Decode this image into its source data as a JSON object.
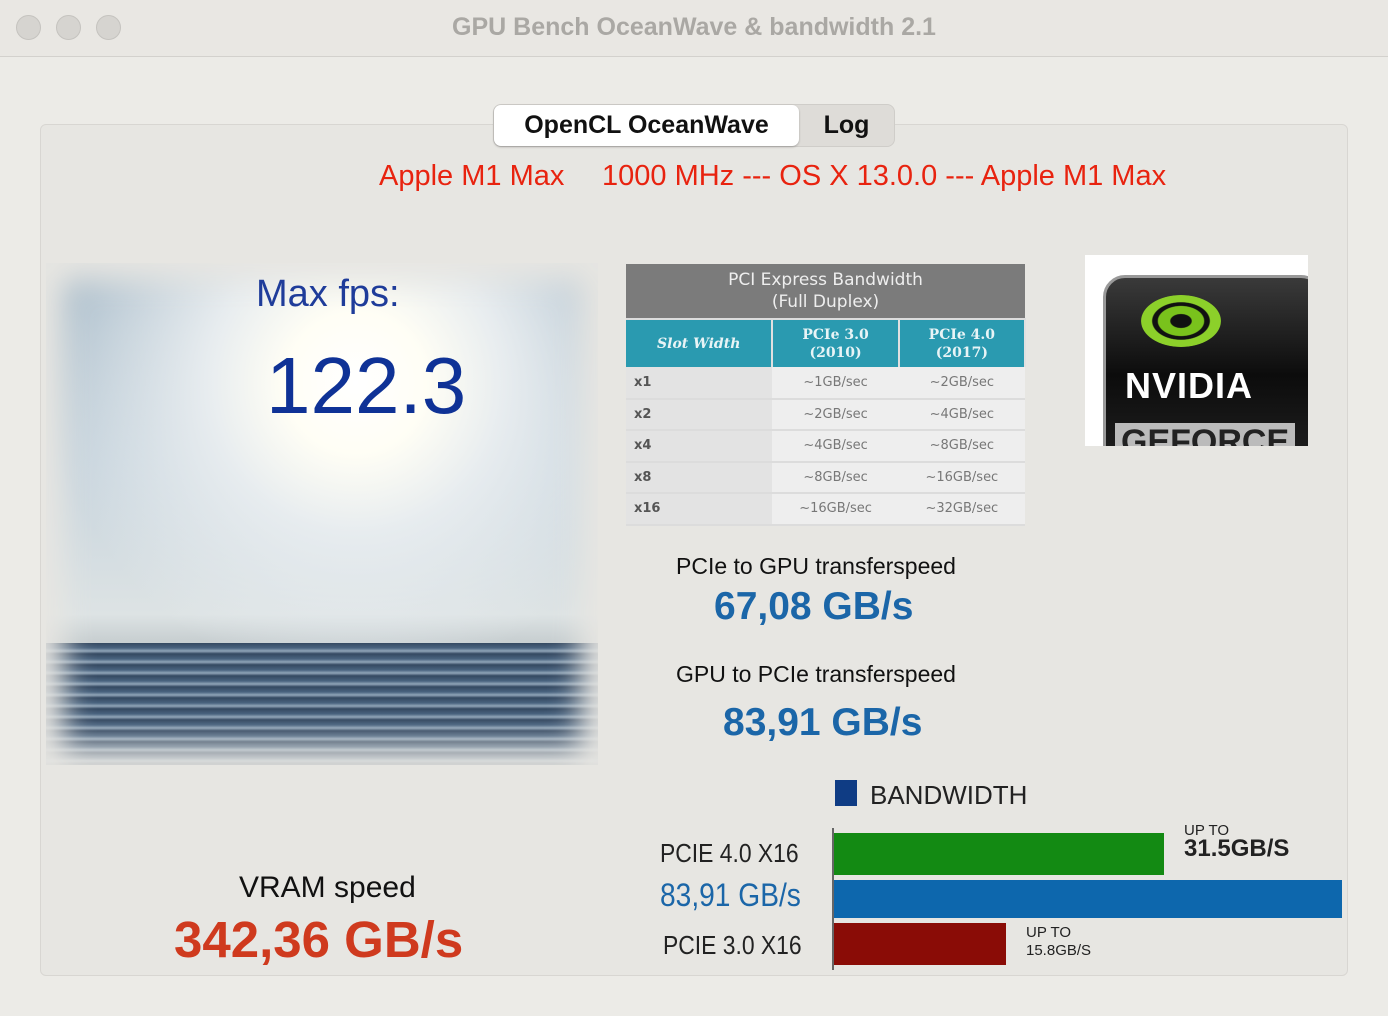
{
  "window": {
    "title": "GPU Bench OceanWave & bandwidth 2.1"
  },
  "tabs": [
    {
      "label": "OpenCL OceanWave",
      "selected": true
    },
    {
      "label": "Log",
      "selected": false
    }
  ],
  "device_info": {
    "gpu": "Apple M1 Max",
    "details": "1000 MHz --- OS X 13.0.0 --- Apple M1 Max"
  },
  "fps": {
    "label": "Max fps:",
    "value": "122.3"
  },
  "pci_table": {
    "title_line1": "PCI Express Bandwidth",
    "title_line2": "(Full Duplex)",
    "headers": [
      {
        "l1": "Slot Width",
        "l2": ""
      },
      {
        "l1": "PCIe 3.0",
        "l2": "(2010)"
      },
      {
        "l1": "PCIe 4.0",
        "l2": "(2017)"
      }
    ],
    "rows": [
      [
        "x1",
        "~1GB/sec",
        "~2GB/sec"
      ],
      [
        "x2",
        "~2GB/sec",
        "~4GB/sec"
      ],
      [
        "x4",
        "~4GB/sec",
        "~8GB/sec"
      ],
      [
        "x8",
        "~8GB/sec",
        "~16GB/sec"
      ],
      [
        "x16",
        "~16GB/sec",
        "~32GB/sec"
      ]
    ]
  },
  "logo": {
    "brand": "NVIDIA",
    "sub": "GEFORCE"
  },
  "transfer": {
    "to_gpu_label": "PCIe to GPU transferspeed",
    "to_gpu_value": "67,08 GB/s",
    "to_pcie_label": "GPU to PCIe transferspeed",
    "to_pcie_value": "83,91 GB/s"
  },
  "vram": {
    "label": "VRAM speed",
    "value": "342,36 GB/s"
  },
  "bandwidth_chart": {
    "legend": "BANDWIDTH",
    "bars": [
      {
        "label": "PCIE 4.0 X16",
        "value": 31.5,
        "note_top": "UP TO",
        "note_value": "31.5GB/S",
        "color": "#138a13"
      },
      {
        "label": "83,91 GB/s",
        "value": 83.91,
        "color": "#0d67ad"
      },
      {
        "label": "PCIE 3.0 X16",
        "value": 15.8,
        "note_top": "UP TO",
        "note_value": "15.8GB/S",
        "color": "#8a0c06"
      }
    ]
  }
}
